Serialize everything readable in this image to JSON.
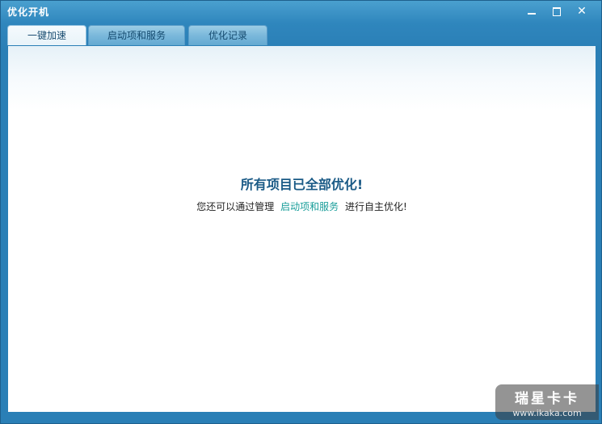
{
  "window": {
    "title": "优化开机"
  },
  "tabs": [
    {
      "label": "一键加速",
      "active": true
    },
    {
      "label": "启动项和服务",
      "active": false
    },
    {
      "label": "优化记录",
      "active": false
    }
  ],
  "main": {
    "headline": "所有项目已全部优化!",
    "sub_prefix": "您还可以通过管理",
    "sub_link": "启动项和服务",
    "sub_suffix": "进行自主优化!"
  },
  "watermark": {
    "brand": "瑞星卡卡",
    "url": "www.ikaka.com"
  },
  "colors": {
    "frame": "#2a7fb6",
    "headline": "#1a5a86",
    "link": "#1a9e9a"
  }
}
